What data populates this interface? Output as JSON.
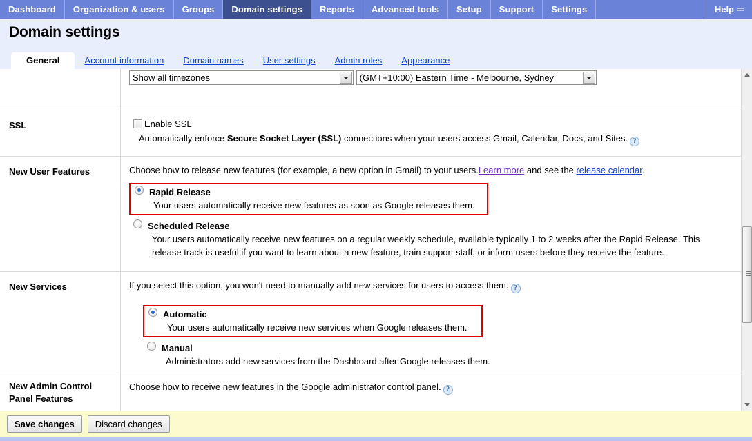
{
  "topnav": {
    "items": [
      {
        "label": "Dashboard",
        "active": false
      },
      {
        "label": "Organization & users",
        "active": false
      },
      {
        "label": "Groups",
        "active": false
      },
      {
        "label": "Domain settings",
        "active": true
      },
      {
        "label": "Reports",
        "active": false
      },
      {
        "label": "Advanced tools",
        "active": false
      },
      {
        "label": "Setup",
        "active": false
      },
      {
        "label": "Support",
        "active": false
      },
      {
        "label": "Settings",
        "active": false
      }
    ],
    "help_label": "Help"
  },
  "header": {
    "page_title": "Domain settings"
  },
  "subtabs": [
    {
      "label": "General",
      "active": true
    },
    {
      "label": "Account information",
      "active": false
    },
    {
      "label": "Domain names",
      "active": false
    },
    {
      "label": "User settings",
      "active": false
    },
    {
      "label": "Admin roles",
      "active": false
    },
    {
      "label": "Appearance",
      "active": false
    }
  ],
  "timezone_row": {
    "filter_select_value": "Show all timezones",
    "timezone_select_value": "(GMT+10:00) Eastern Time - Melbourne, Sydney"
  },
  "ssl_row": {
    "label": "SSL",
    "checkbox_label": "Enable SSL",
    "checkbox_checked": false,
    "description_pre": "Automatically enforce ",
    "description_bold": "Secure Socket Layer (SSL)",
    "description_post": " connections when your users access Gmail, Calendar, Docs, and Sites.",
    "help_icon": "question-mark-icon"
  },
  "new_user_features_row": {
    "label": "New User Features",
    "description_pre": "Choose how to release new features (for example, a new option in Gmail) to your users.",
    "link_learn_more": "Learn more",
    "description_mid": " and see the ",
    "link_release_calendar": "release calendar",
    "description_post": ".",
    "options": [
      {
        "title": "Rapid Release",
        "desc": "Your users automatically receive new features as soon as Google releases them.",
        "checked": true,
        "highlighted": true
      },
      {
        "title": "Scheduled Release",
        "desc": "Your users automatically receive new features on a regular weekly schedule, available typically 1 to 2 weeks after the Rapid Release. This release track is useful if you want to learn about a new feature, train support staff, or inform users before they receive the feature.",
        "checked": false,
        "highlighted": false
      }
    ]
  },
  "new_services_row": {
    "label": "New Services",
    "description": "If you select this option, you won't need to manually add new services for users to access them.",
    "help_icon": "question-mark-icon",
    "options": [
      {
        "title": "Automatic",
        "desc": "Your users automatically receive new services when Google releases them.",
        "checked": true,
        "highlighted": true
      },
      {
        "title": "Manual",
        "desc": "Administrators add new services from the Dashboard after Google releases them.",
        "checked": false,
        "highlighted": false
      }
    ]
  },
  "new_admin_row": {
    "label": "New Admin Control Panel Features",
    "description": "Choose how to receive new features in the Google administrator control panel.",
    "help_icon": "question-mark-icon"
  },
  "footer": {
    "save_label": "Save changes",
    "discard_label": "Discard changes"
  },
  "colors": {
    "nav_background": "#6b82d9",
    "nav_active": "#3c4f8f",
    "header_band": "#e8eefb",
    "link": "#1144cc",
    "link_visited": "#7030c0",
    "highlight_border": "#e00000",
    "footer_background": "#fbfbcd",
    "radio_dot": "#2163c9"
  }
}
